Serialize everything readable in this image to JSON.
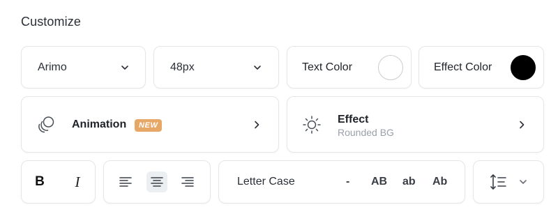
{
  "section": {
    "title": "Customize"
  },
  "font": {
    "value": "Arimo",
    "icon": "chevron-down-icon"
  },
  "size": {
    "value": "48px",
    "icon": "chevron-down-icon"
  },
  "text_color": {
    "label": "Text Color",
    "color": "#ffffff"
  },
  "effect_color": {
    "label": "Effect Color",
    "color": "#000000"
  },
  "animation": {
    "label": "Animation",
    "badge": "NEW",
    "badge_color": "#e7a766",
    "icon": "animation-circles-icon",
    "arrow": "chevron-right-icon"
  },
  "effect": {
    "label": "Effect",
    "value": "Rounded BG",
    "icon": "sun-icon",
    "arrow": "chevron-right-icon"
  },
  "format": {
    "bold": "B",
    "italic": "I"
  },
  "align": {
    "options": [
      "left",
      "center",
      "right"
    ],
    "selected": "center"
  },
  "letter_case": {
    "label": "Letter Case",
    "options": [
      "-",
      "AB",
      "ab",
      "Ab"
    ]
  },
  "line_height": {
    "icon": "line-height-icon",
    "dropdown": "chevron-down-icon"
  },
  "colors": {
    "border": "#e4e6ea",
    "active_bg": "#eceff2",
    "muted_text": "#9aa0a8"
  }
}
